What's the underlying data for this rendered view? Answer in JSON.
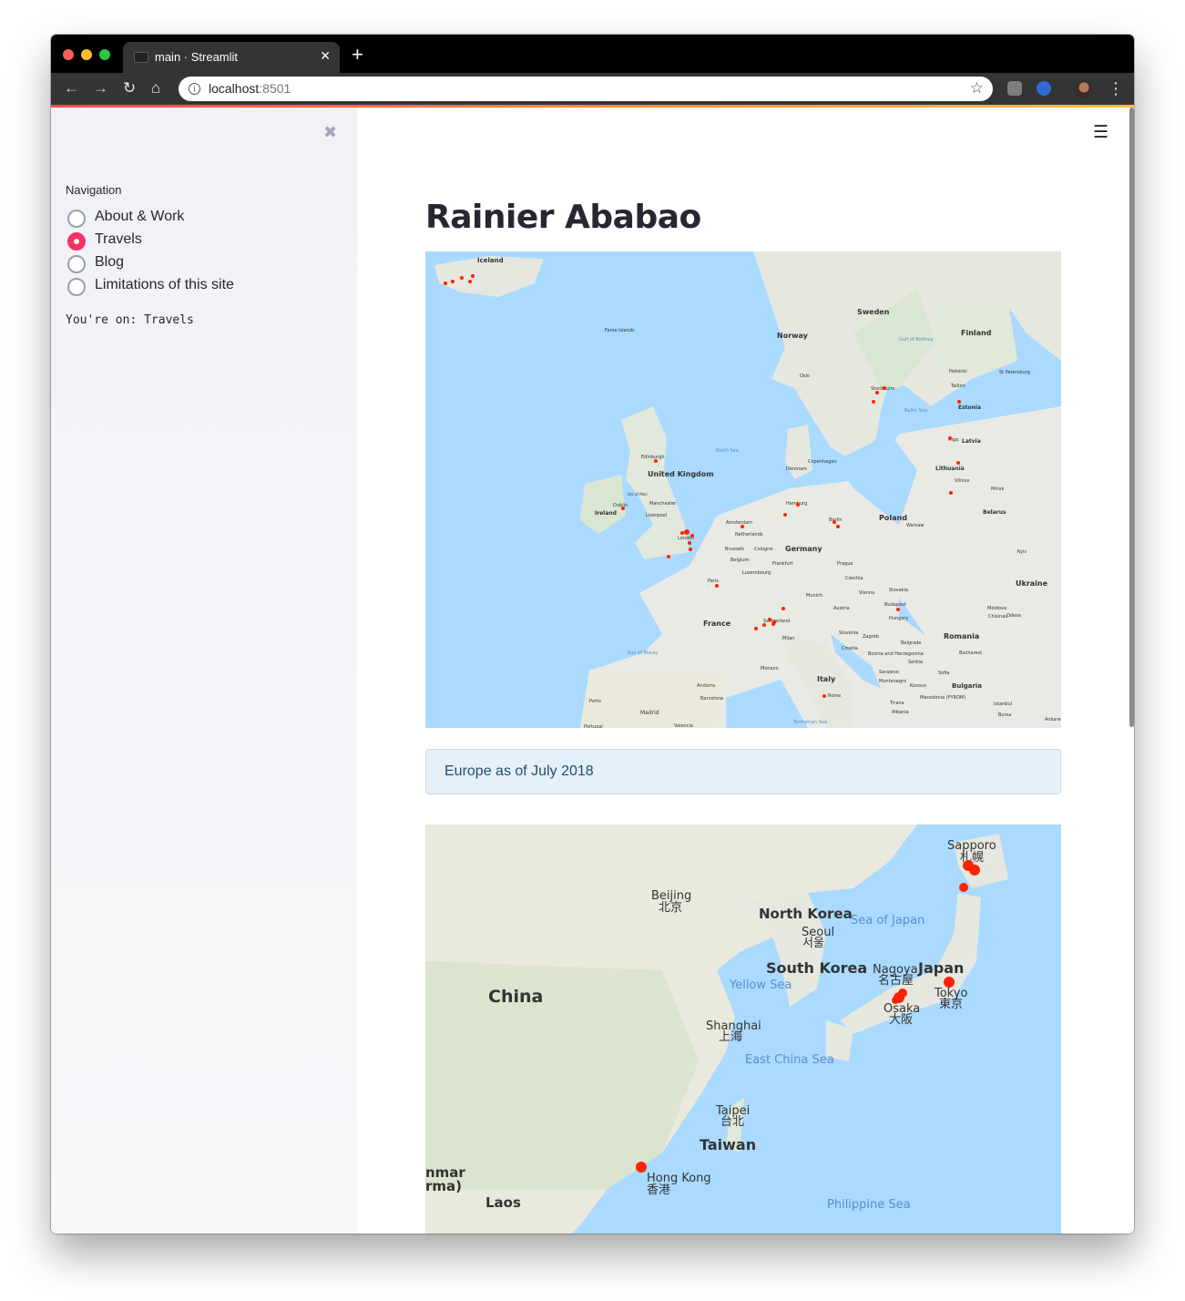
{
  "browser": {
    "tab_title": "main · Streamlit",
    "tab_close": "✕",
    "new_tab": "+",
    "url_host": "localhost",
    "url_port": ":8501",
    "back_icon": "←",
    "forward_icon": "→",
    "reload_icon": "↻",
    "home_icon": "⌂",
    "star_icon": "☆",
    "menu_icon": "⋮"
  },
  "sidebar": {
    "close_icon": "✖",
    "nav_title": "Navigation",
    "options": [
      {
        "label": "About & Work",
        "checked": false
      },
      {
        "label": "Travels",
        "checked": true
      },
      {
        "label": "Blog",
        "checked": false
      },
      {
        "label": "Limitations of this site",
        "checked": false
      }
    ],
    "status": "You're on: Travels"
  },
  "main": {
    "menu_icon": "☰",
    "title": "Rainier Ababao",
    "caption": "Europe as of July 2018"
  },
  "maps": {
    "europe": {
      "labels": [
        "Iceland",
        "Faroe Islands",
        "Norway",
        "Sweden",
        "Finland",
        "Oslo",
        "Stockholm",
        "Helsinki",
        "St Petersburg",
        "Tallinn",
        "Estonia",
        "Riga",
        "Latvia",
        "Lithuania",
        "Vilnius",
        "Minsk",
        "Belarus",
        "Edinburgh",
        "United Kingdom",
        "Isle of Man",
        "Dublin",
        "Ireland",
        "Manchester",
        "Liverpool",
        "London",
        "North Sea",
        "Denmark",
        "Copenhagen",
        "Hamburg",
        "Amsterdam",
        "Netherlands",
        "Berlin",
        "Poland",
        "Warsaw",
        "Brussels",
        "Belgium",
        "Cologne",
        "Germany",
        "Frankfurt",
        "Luxembourg",
        "Prague",
        "Czechia",
        "Kyiv",
        "Ukraine",
        "Paris",
        "Munich",
        "Vienna",
        "Slovakia",
        "Budapest",
        "Hungary",
        "Austria",
        "Switzerland",
        "Moldova",
        "Chisinau",
        "Odesa",
        "France",
        "Milan",
        "Slovenia",
        "Zagreb",
        "Croatia",
        "Romania",
        "Bucharest",
        "Bay of Biscay",
        "Monaco",
        "Belgrade",
        "Serbia",
        "Bosnia and Herzegovina",
        "Sarajevo",
        "Montenegro",
        "Kosovo",
        "Sofia",
        "Bulgaria",
        "Andorra",
        "Barcelona",
        "Italy",
        "Rome",
        "Macedonia (FYROM)",
        "Tirana",
        "Albania",
        "Istanbul",
        "Porto",
        "Madrid",
        "Valencia",
        "Portugal",
        "Tyrrhenian Sea",
        "Bursa",
        "Ankara",
        "Baltic Sea",
        "Gulf of Bothnia"
      ]
    },
    "asia": {
      "labels": [
        "Sapporo",
        "札幌",
        "Beijing",
        "北京",
        "North Korea",
        "Seoul",
        "서울",
        "Sea of Japan",
        "South Korea",
        "Nagoya",
        "名古屋",
        "Japan",
        "Yellow Sea",
        "China",
        "Osaka",
        "大阪",
        "Tokyo",
        "東京",
        "Shanghai",
        "上海",
        "East China Sea",
        "Taipei",
        "台北",
        "Taiwan",
        "nmar",
        "rma)",
        "Hong Kong",
        "香港",
        "Laos",
        "Philippine Sea"
      ]
    },
    "colors": {
      "water": "#aadaff",
      "land": "#e8eae3",
      "marker": "#ff2200",
      "accent": "#f63366"
    }
  }
}
